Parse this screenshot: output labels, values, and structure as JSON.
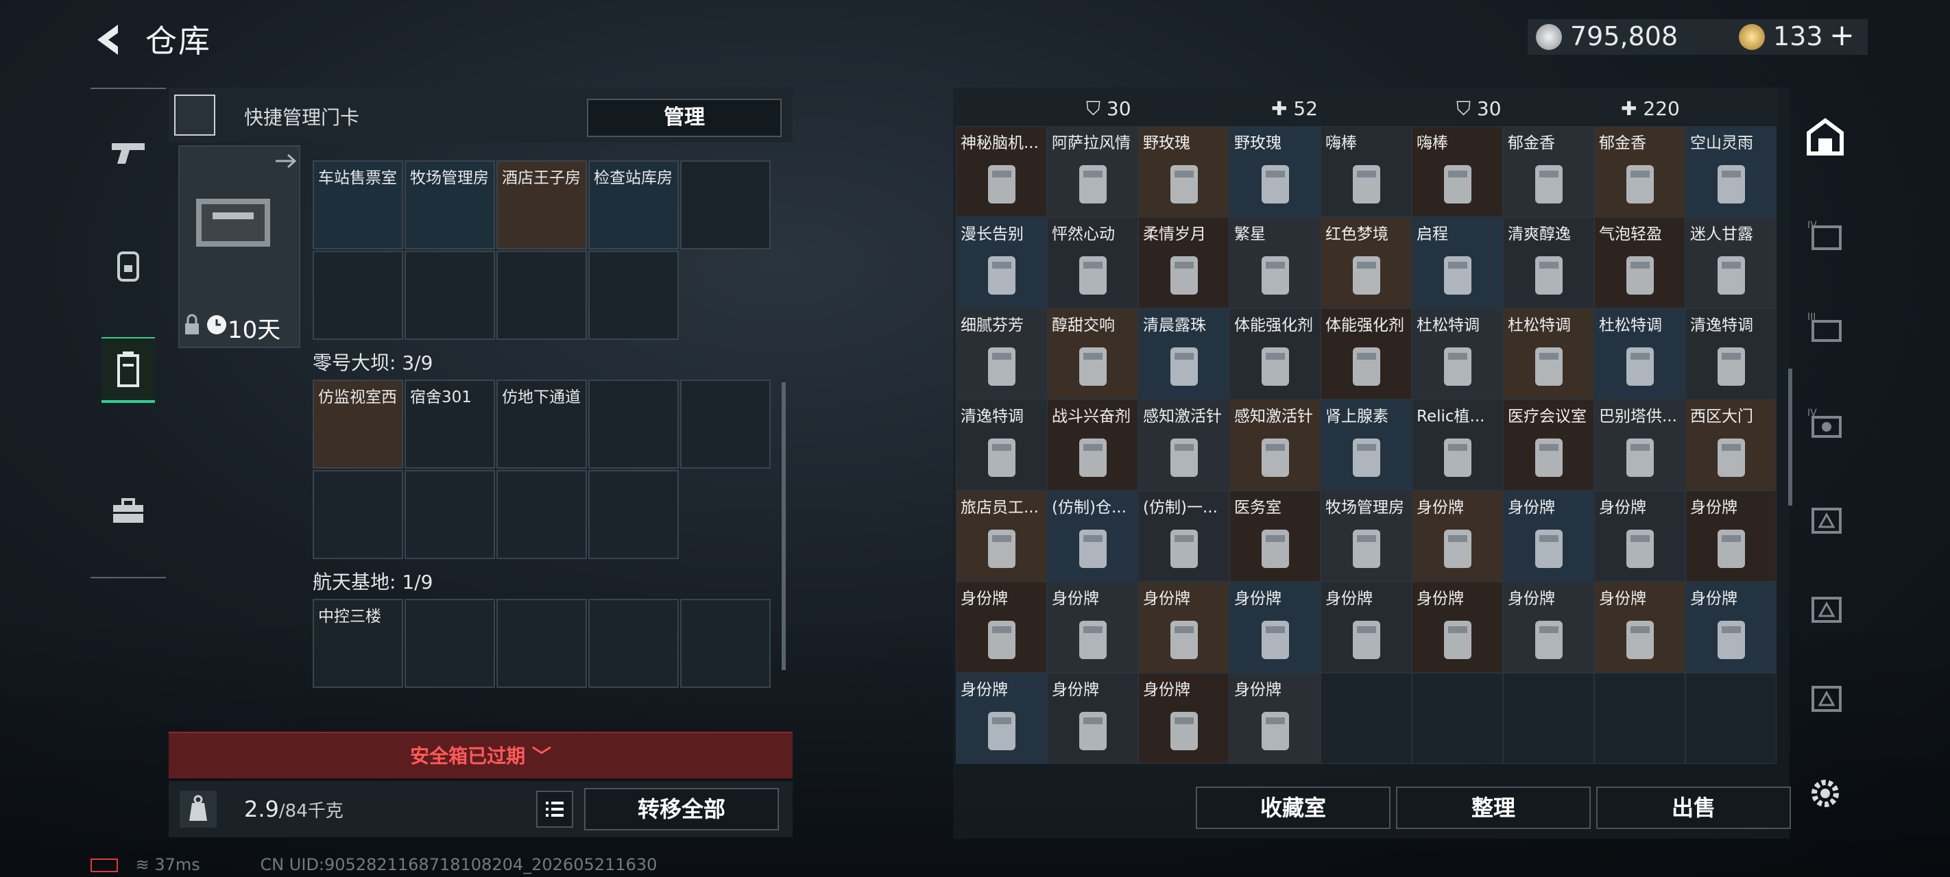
{
  "header": {
    "title": "仓库",
    "currency1": "795,808",
    "currency2": "133",
    "plus": "+"
  },
  "quick": {
    "label": "快捷管理门卡",
    "manage": "管理"
  },
  "card": {
    "days": "10天"
  },
  "sections": [
    {
      "title": "",
      "slots": [
        "车站售票室",
        "牧场管理房",
        "酒店王子房",
        "检查站库房"
      ]
    },
    {
      "title": "零号大坝: 3/9",
      "slots": [
        "仿监视室西",
        "宿舍301",
        "仿地下通道"
      ]
    },
    {
      "title": "航天基地: 1/9",
      "slots": [
        "中控三楼"
      ]
    }
  ],
  "expired": "安全箱已过期",
  "weight": {
    "value": "2.9",
    "unit": "/84千克"
  },
  "transfer": "转移全部",
  "right": {
    "top": [
      {
        "label": "30"
      },
      {
        "label": "52"
      },
      {
        "label": "30"
      },
      {
        "label": "220"
      }
    ],
    "items": [
      [
        "神秘脑机...",
        "阿萨拉风情",
        "野玫瑰",
        "野玫瑰",
        "嗨棒",
        "嗨棒",
        "郁金香",
        "郁金香",
        "空山灵雨"
      ],
      [
        "漫长告别",
        "怦然心动",
        "柔情岁月",
        "繁星",
        "红色梦境",
        "启程",
        "清爽醇逸",
        "气泡轻盈",
        "迷人甘露"
      ],
      [
        "细腻芬芳",
        "醇甜交响",
        "清晨露珠",
        "体能强化剂",
        "体能强化剂",
        "杜松特调",
        "杜松特调",
        "杜松特调",
        "清逸特调"
      ],
      [
        "清逸特调",
        "战斗兴奋剂",
        "感知激活针",
        "感知激活针",
        "肾上腺素",
        "Relic植...",
        "医疗会议室",
        "巴别塔供...",
        "西区大门"
      ],
      [
        "旅店员工...",
        "(仿制)仓...",
        "(仿制)一...",
        "医务室",
        "牧场管理房",
        "身份牌",
        "身份牌",
        "身份牌",
        "身份牌"
      ],
      [
        "身份牌",
        "身份牌",
        "身份牌",
        "身份牌",
        "身份牌",
        "身份牌",
        "身份牌",
        "身份牌",
        "身份牌"
      ],
      [
        "身份牌",
        "身份牌",
        "身份牌",
        "身份牌"
      ]
    ],
    "buttons": {
      "collection": "收藏室",
      "sort": "整理",
      "sell": "出售"
    }
  },
  "status": {
    "ping": "37ms",
    "uid": "CN UID:9052821168718108204_202605211630"
  }
}
